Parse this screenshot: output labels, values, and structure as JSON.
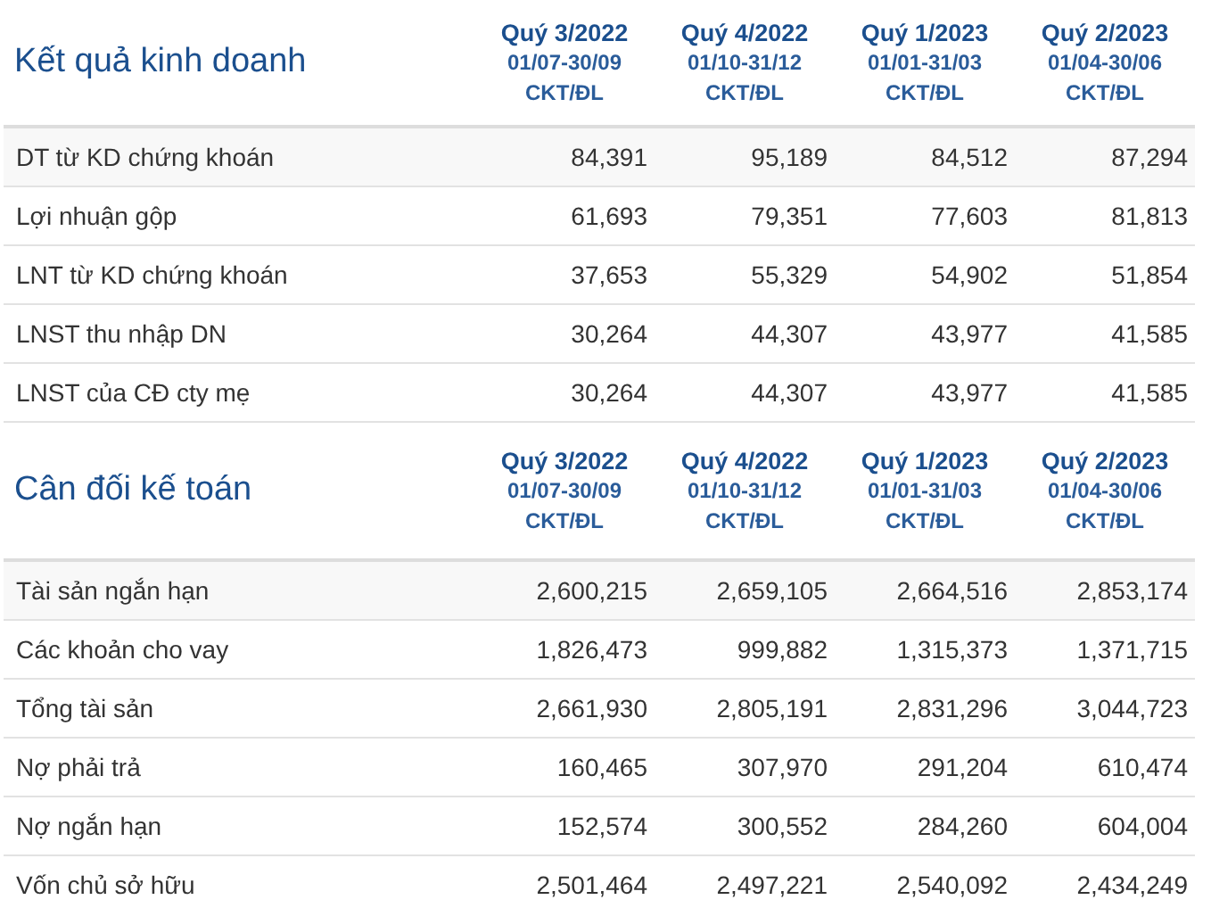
{
  "sections": [
    {
      "title": "Kết quả kinh doanh",
      "columns": [
        {
          "period": "Quý 3/2022",
          "dates": "01/07-30/09",
          "audit": "CKT/ĐL"
        },
        {
          "period": "Quý 4/2022",
          "dates": "01/10-31/12",
          "audit": "CKT/ĐL"
        },
        {
          "period": "Quý 1/2023",
          "dates": "01/01-31/03",
          "audit": "CKT/ĐL"
        },
        {
          "period": "Quý 2/2023",
          "dates": "01/04-30/06",
          "audit": "CKT/ĐL"
        }
      ],
      "rows": [
        {
          "label": "DT từ KD chứng khoán",
          "values": [
            "84,391",
            "95,189",
            "84,512",
            "87,294"
          ]
        },
        {
          "label": "Lợi nhuận gộp",
          "values": [
            "61,693",
            "79,351",
            "77,603",
            "81,813"
          ]
        },
        {
          "label": "LNT từ KD chứng khoán",
          "values": [
            "37,653",
            "55,329",
            "54,902",
            "51,854"
          ]
        },
        {
          "label": "LNST thu nhập DN",
          "values": [
            "30,264",
            "44,307",
            "43,977",
            "41,585"
          ]
        },
        {
          "label": "LNST của CĐ cty mẹ",
          "values": [
            "30,264",
            "44,307",
            "43,977",
            "41,585"
          ]
        }
      ]
    },
    {
      "title": "Cân đối kế toán",
      "columns": [
        {
          "period": "Quý 3/2022",
          "dates": "01/07-30/09",
          "audit": "CKT/ĐL"
        },
        {
          "period": "Quý 4/2022",
          "dates": "01/10-31/12",
          "audit": "CKT/ĐL"
        },
        {
          "period": "Quý 1/2023",
          "dates": "01/01-31/03",
          "audit": "CKT/ĐL"
        },
        {
          "period": "Quý 2/2023",
          "dates": "01/04-30/06",
          "audit": "CKT/ĐL"
        }
      ],
      "rows": [
        {
          "label": "Tài sản ngắn hạn",
          "values": [
            "2,600,215",
            "2,659,105",
            "2,664,516",
            "2,853,174"
          ]
        },
        {
          "label": "Các khoản cho vay",
          "values": [
            "1,826,473",
            "999,882",
            "1,315,373",
            "1,371,715"
          ]
        },
        {
          "label": "Tổng tài sản",
          "values": [
            "2,661,930",
            "2,805,191",
            "2,831,296",
            "3,044,723"
          ]
        },
        {
          "label": "Nợ phải trả",
          "values": [
            "160,465",
            "307,970",
            "291,204",
            "610,474"
          ]
        },
        {
          "label": "Nợ ngắn hạn",
          "values": [
            "152,574",
            "300,552",
            "284,260",
            "604,004"
          ]
        },
        {
          "label": "Vốn chủ sở hữu",
          "values": [
            "2,501,464",
            "2,497,221",
            "2,540,092",
            "2,434,249"
          ]
        }
      ]
    }
  ]
}
